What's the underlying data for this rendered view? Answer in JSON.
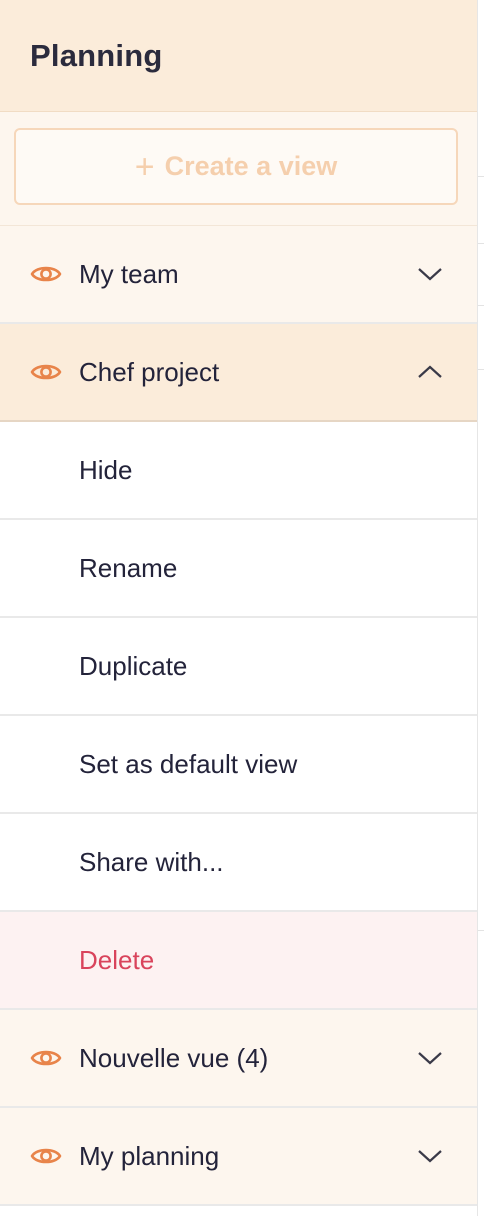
{
  "header": {
    "title": "Planning"
  },
  "create_view": {
    "label": "Create a view",
    "icon": "plus-icon"
  },
  "views": [
    {
      "label": "My team",
      "expanded": false
    },
    {
      "label": "Chef project",
      "expanded": true
    },
    {
      "label": "Nouvelle vue (4)",
      "expanded": false
    },
    {
      "label": "My planning",
      "expanded": false
    }
  ],
  "menu": {
    "hide": "Hide",
    "rename": "Rename",
    "duplicate": "Duplicate",
    "set_default": "Set as default view",
    "share": "Share with...",
    "delete": "Delete"
  },
  "colors": {
    "header_bg": "#fbecda",
    "view_bg": "#fdf6ee",
    "accent_orange": "#e8844a",
    "delete_red": "#d9445c",
    "delete_bg": "#fdf2f2"
  }
}
